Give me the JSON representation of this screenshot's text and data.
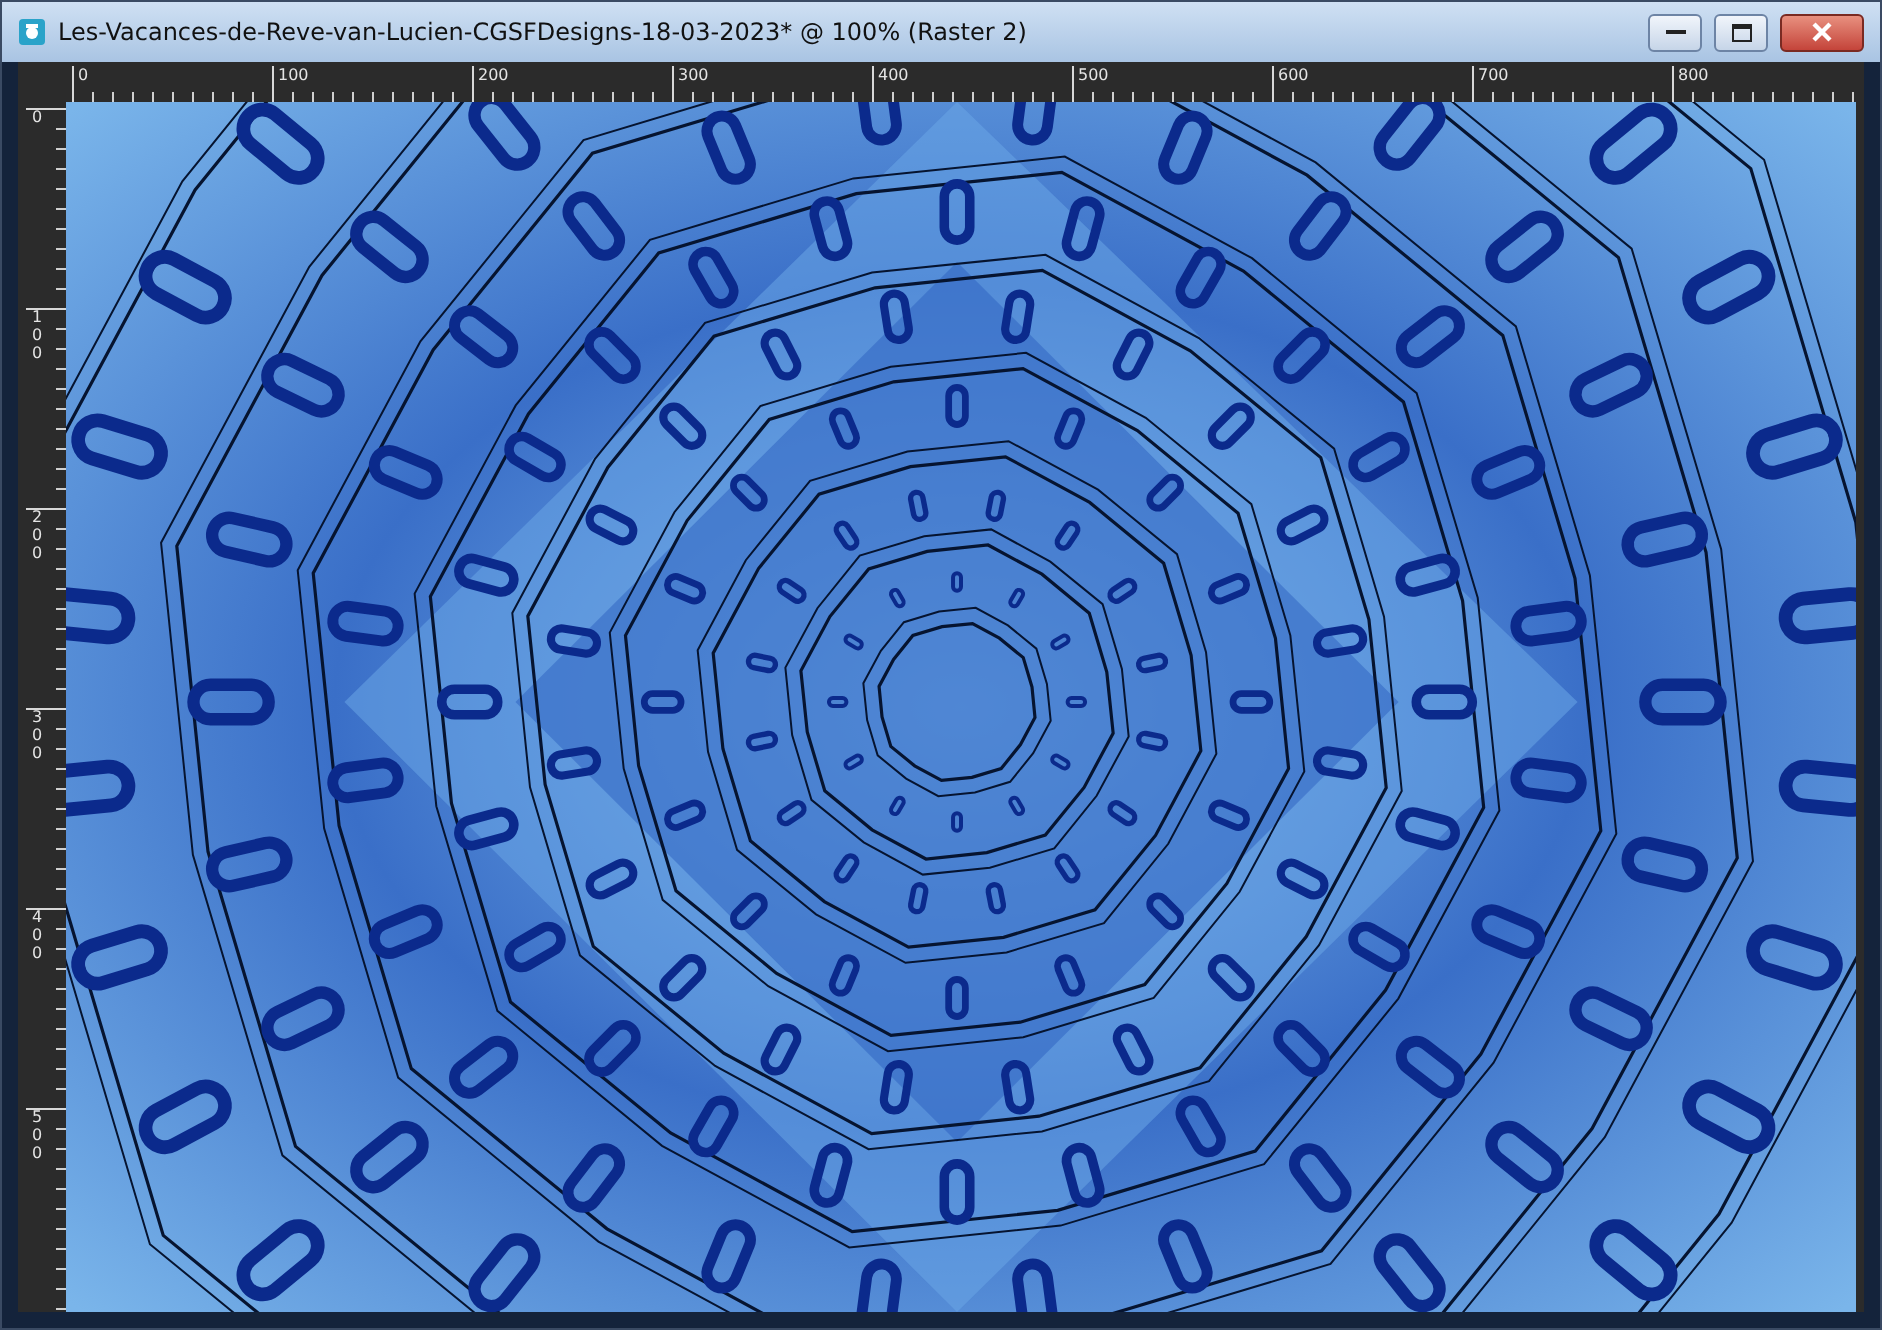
{
  "window": {
    "title": "Les-Vacances-de-Reve-van-Lucien-CGSFDesigns-18-03-2023* @ 100% (Raster 2)"
  },
  "rulers": {
    "horizontal": [
      "0",
      "100",
      "200",
      "300",
      "400",
      "500",
      "600",
      "700",
      "800"
    ],
    "vertical": [
      "0",
      "100",
      "200",
      "300",
      "400",
      "500"
    ]
  }
}
